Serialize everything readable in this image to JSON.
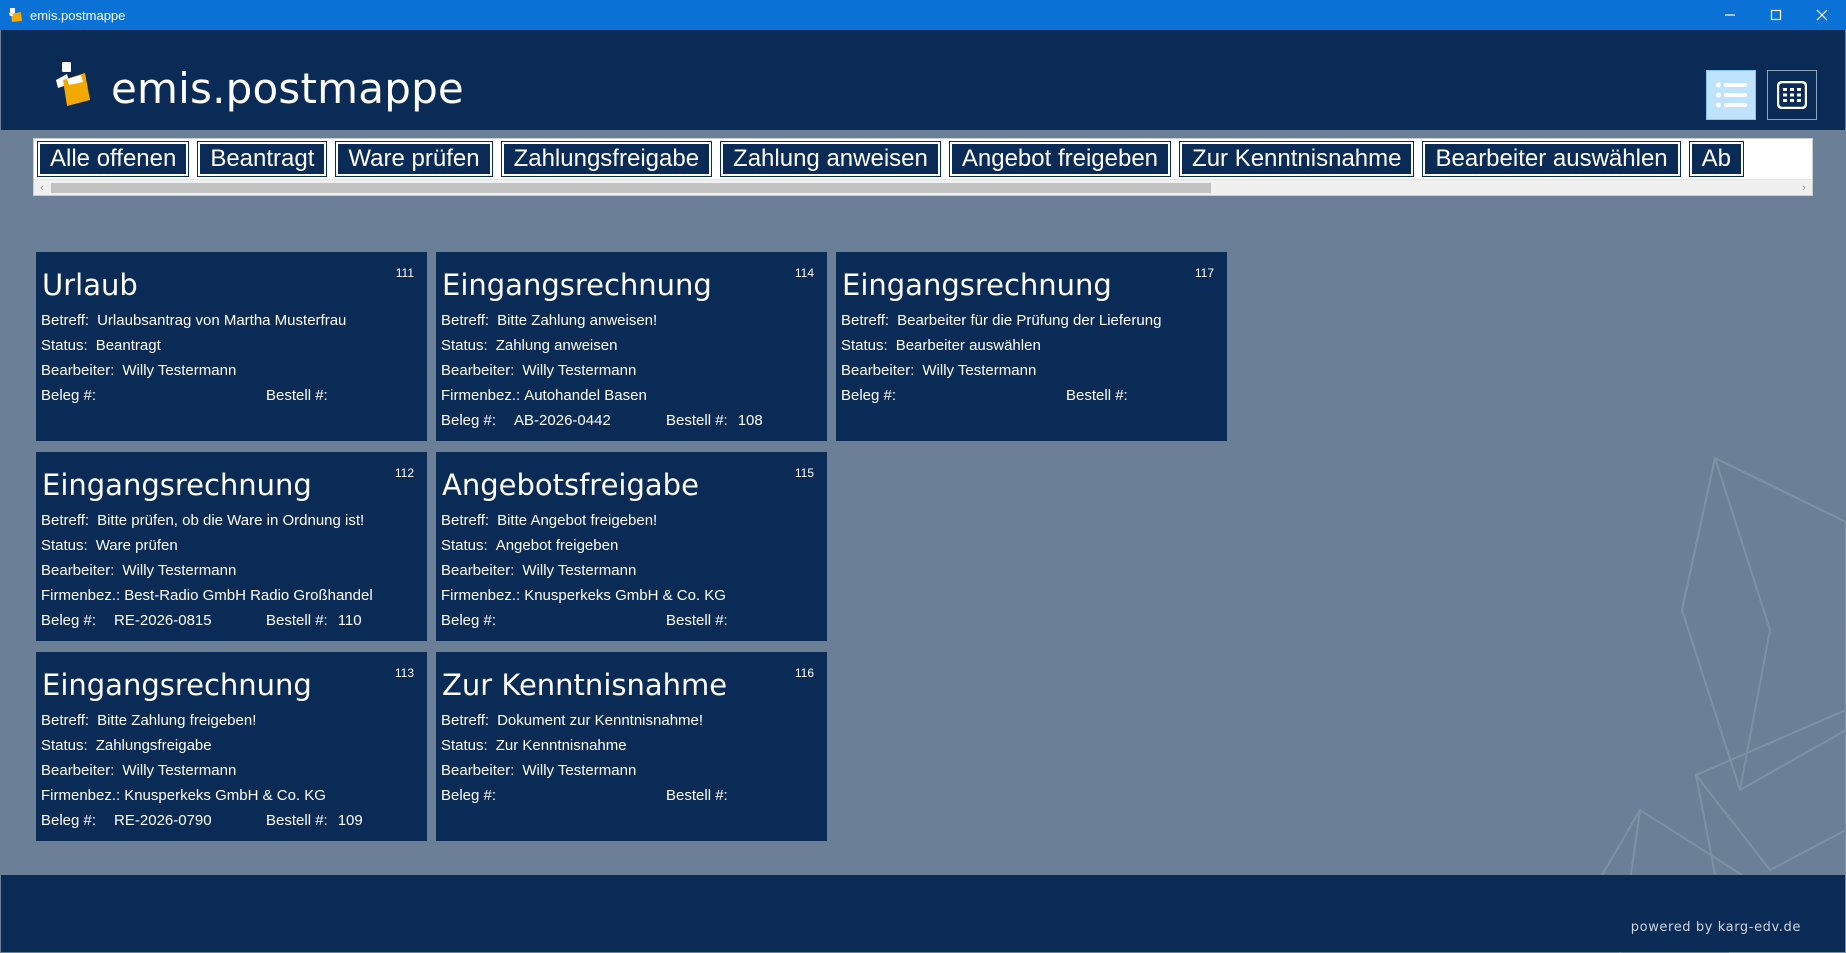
{
  "window": {
    "title": "emis.postmappe",
    "app_icon": "emis-app-icon",
    "controls": [
      "minimize-icon",
      "maximize-icon",
      "close-icon"
    ]
  },
  "header": {
    "brand": "emis.postmappe",
    "logo_icon": "folder-logo-icon",
    "view_buttons": [
      {
        "name": "list-view",
        "icon": "list-view-icon",
        "active": true
      },
      {
        "name": "grid-view",
        "icon": "grid-view-icon",
        "active": false
      }
    ]
  },
  "filters": [
    "Alle offenen",
    "Beantragt",
    "Ware prüfen",
    "Zahlungsfreigabe",
    "Zahlung anweisen",
    "Angebot freigeben",
    "Zur Kenntnisnahme",
    "Bearbeiter auswählen",
    "Ab"
  ],
  "labels": {
    "betreff": "Betreff:",
    "status": "Status:",
    "bearbeiter": "Bearbeiter:",
    "firmenbez": "Firmenbez.:",
    "beleg": "Beleg #:",
    "bestell": "Bestell #:"
  },
  "cards": [
    {
      "id": "111",
      "title": "Urlaub",
      "betreff": "Urlaubsantrag von Martha Musterfrau",
      "status": "Beantragt",
      "bearbeiter": "Willy Testermann",
      "firmenbez": null,
      "beleg": "",
      "bestell": ""
    },
    {
      "id": "114",
      "title": "Eingangsrechnung",
      "betreff": "Bitte Zahlung anweisen!",
      "status": "Zahlung anweisen",
      "bearbeiter": "Willy Testermann",
      "firmenbez": "Autohandel Basen",
      "beleg": "AB-2026-0442",
      "bestell": "108"
    },
    {
      "id": "117",
      "title": "Eingangsrechnung",
      "betreff": "Bearbeiter für die Prüfung der Lieferung",
      "status": "Bearbeiter auswählen",
      "bearbeiter": "Willy Testermann",
      "firmenbez": null,
      "beleg": "",
      "bestell": ""
    },
    {
      "id": "112",
      "title": "Eingangsrechnung",
      "betreff": "Bitte prüfen, ob die Ware in Ordnung ist!",
      "status": "Ware prüfen",
      "bearbeiter": "Willy Testermann",
      "firmenbez": "Best-Radio GmbH Radio Großhandel",
      "beleg": "RE-2026-0815",
      "bestell": "110"
    },
    {
      "id": "115",
      "title": "Angebotsfreigabe",
      "betreff": "Bitte Angebot freigeben!",
      "status": "Angebot freigeben",
      "bearbeiter": "Willy Testermann",
      "firmenbez": "Knusperkeks GmbH & Co. KG",
      "beleg": "",
      "bestell": ""
    },
    {
      "id": "113",
      "title": "Eingangsrechnung",
      "betreff": "Bitte Zahlung freigeben!",
      "status": "Zahlungsfreigabe",
      "bearbeiter": "Willy Testermann",
      "firmenbez": "Knusperkeks GmbH & Co. KG",
      "beleg": "RE-2026-0790",
      "bestell": "109"
    },
    {
      "id": "116",
      "title": "Zur Kenntnisnahme",
      "betreff": "Dokument zur Kenntnisnahme!",
      "status": "Zur Kenntnisnahme",
      "bearbeiter": "Willy Testermann",
      "firmenbez": null,
      "beleg": "",
      "bestell": ""
    }
  ],
  "footer": {
    "powered": "powered by karg-edv.de"
  },
  "colors": {
    "titlebar": "#0a72d6",
    "navy": "#0b2b57",
    "workspace": "#6b8096",
    "active_view": "#bfe3ff"
  }
}
